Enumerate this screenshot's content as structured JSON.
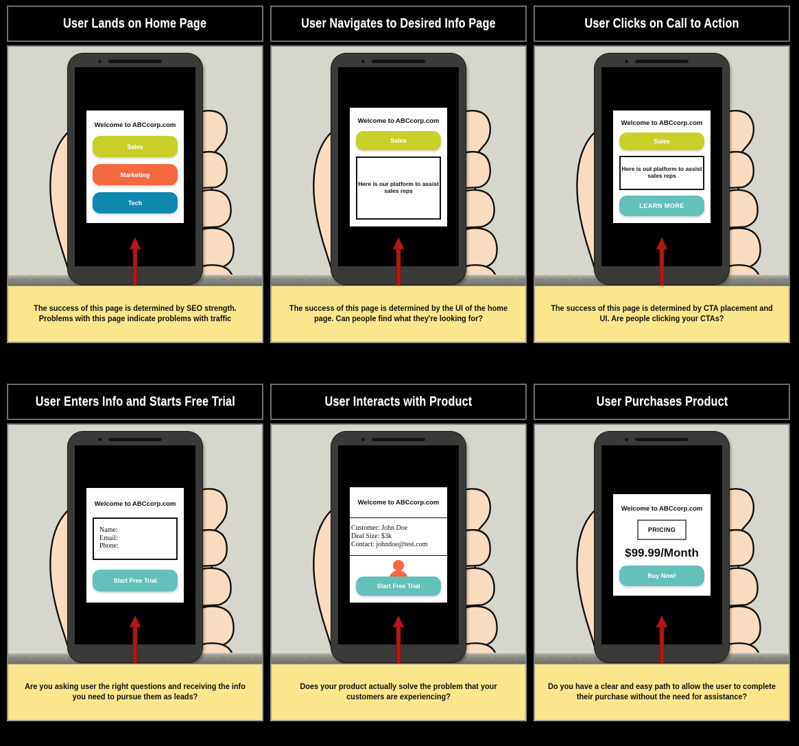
{
  "storyboard": {
    "app_title": "Welcome to ABCcorp.com",
    "colors": {
      "sales": "#c9d02a",
      "marketing": "#f4693f",
      "tech": "#1089b0",
      "cta_teal": "#64c0bb",
      "avatar": "#f4693f",
      "arrow": "#b41717",
      "sticky": "#fbe68e",
      "scene_bg": "#d6d6cc",
      "phone_body": "#3a3a38"
    },
    "panels": [
      {
        "title": "User Lands on Home Page",
        "caption": "The success of this page is determined by SEO strength. Problems with this page indicate problems with traffic",
        "screen": {
          "heading": "Welcome to ABCcorp.com",
          "buttons": [
            {
              "label": "Sales",
              "color": "#c9d02a"
            },
            {
              "label": "Marketing",
              "color": "#f4693f"
            },
            {
              "label": "Tech",
              "color": "#1089b0"
            }
          ]
        }
      },
      {
        "title": "User Navigates to Desired Info Page",
        "caption": "The success of this page is determined by the UI of the home page. Can people find what they're looking for?",
        "screen": {
          "heading": "Welcome to ABCcorp.com",
          "button_label": "Sales",
          "info_text": "Here is our platform to assist sales reps"
        }
      },
      {
        "title": "User Clicks on Call to Action",
        "caption": "The success of this page is determined by CTA placement and UI. Are people clicking your CTAs?",
        "screen": {
          "heading": "Welcome to ABCcorp.com",
          "button_label": "Sales",
          "info_text": "Here is out platform to assist sales reps",
          "cta_label": "LEARN MORE"
        }
      },
      {
        "title": "User Enters Info and Starts Free Trial",
        "caption": "Are you asking user the right questions and receiving the info you need to pursue them as leads?",
        "screen": {
          "heading": "Welcome to ABCcorp.com",
          "form_fields": [
            "Name:",
            "Email:",
            "Phone:"
          ],
          "cta_label": "Start Free Trial"
        }
      },
      {
        "title": "User Interacts with Product",
        "caption": "Does your product actually solve the problem that your customers are experiencing?",
        "screen": {
          "heading": "Welcome to ABCcorp.com",
          "record": {
            "customer": "Customer: John Doe",
            "deal_size": "Deal Size: $3k",
            "contact": "Contact: johndoe@test.com"
          },
          "cta_label": "Start Free Trial"
        }
      },
      {
        "title": "User Purchases Product",
        "caption": "Do you have a clear and easy path to allow the user to complete their purchase without the need for assistance?",
        "screen": {
          "heading": "Welcome to ABCcorp.com",
          "pricing_tag": "PRICING",
          "price": "$99.99/Month",
          "cta_label": "Buy Now!"
        }
      }
    ]
  }
}
